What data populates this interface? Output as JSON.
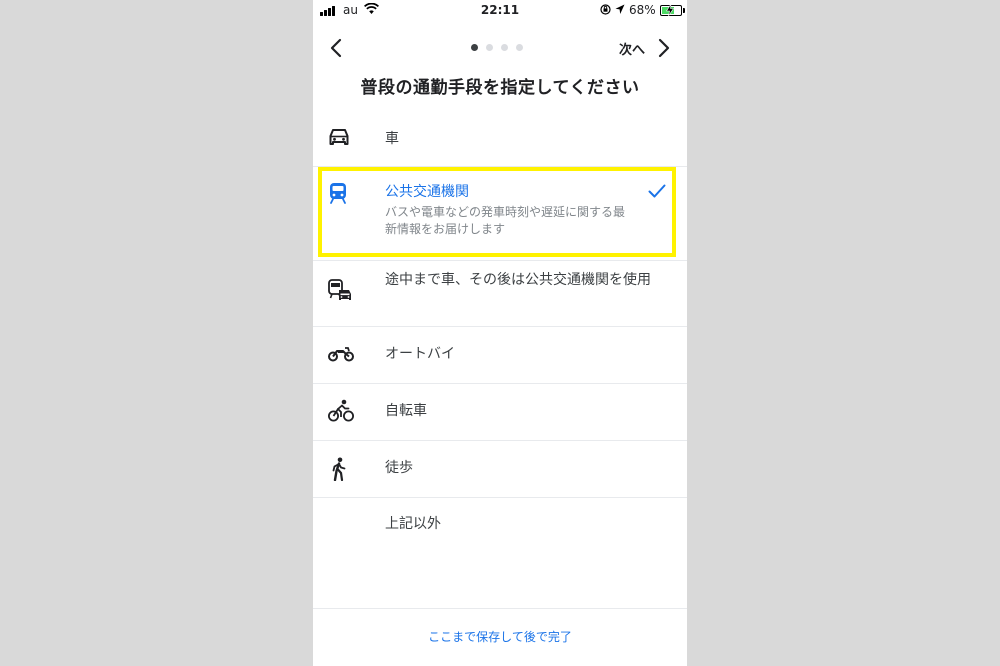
{
  "status_bar": {
    "carrier": "au",
    "time": "22:11",
    "battery_percent": "68%",
    "battery_level": 0.68,
    "icons": [
      "signal-icon",
      "wifi-icon",
      "orientation-lock-icon",
      "location-icon",
      "battery-charging-icon"
    ]
  },
  "nav": {
    "next_label": "次へ",
    "page_dots_total": 4,
    "page_dots_active": 1
  },
  "page_title": "普段の通勤手段を指定してください",
  "options": [
    {
      "label": "車",
      "icon": "car-icon",
      "selected": false
    },
    {
      "label": "公共交通機関",
      "description": "バスや電車などの発車時刻や遅延に関する最新情報をお届けします",
      "icon": "train-icon",
      "selected": true
    },
    {
      "label": "途中まで車、その後は公共交通機関を使用",
      "icon": "park-and-ride-icon",
      "selected": false
    },
    {
      "label": "オートバイ",
      "icon": "motorcycle-icon",
      "selected": false
    },
    {
      "label": "自転車",
      "icon": "bicycle-icon",
      "selected": false
    },
    {
      "label": "徒歩",
      "icon": "walking-icon",
      "selected": false
    },
    {
      "label": "上記以外",
      "icon": "",
      "selected": false
    }
  ],
  "footer": {
    "save_later_label": "ここまで保存して後で完了"
  },
  "colors": {
    "accent_blue": "#1a73e8",
    "highlight_yellow": "#fff200",
    "background_gray": "#d9d9d9",
    "battery_green": "#4cd964"
  }
}
